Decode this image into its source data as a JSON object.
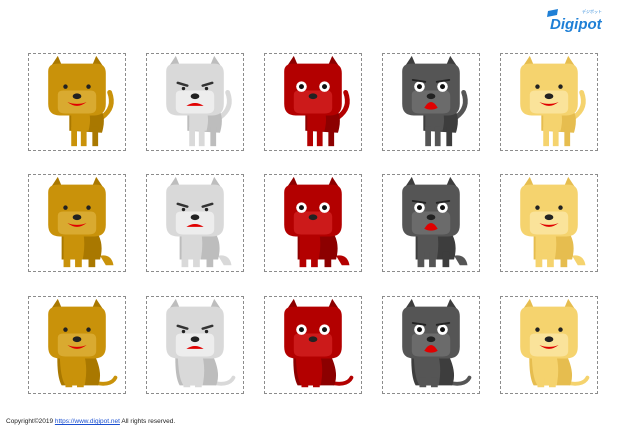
{
  "logo": {
    "text": "Digipot",
    "small_text": "デジポット",
    "icon": "digipot-logo-icon",
    "color": "#1e7fd6"
  },
  "footer": {
    "prefix": "Copyright©2019 ",
    "link_text": "https://www.digipot.net",
    "suffix": " All rights reserved."
  },
  "palette": {
    "tan": {
      "body": "#c9920a",
      "shade": "#a97800",
      "snout": "#d9aa30"
    },
    "white": {
      "body": "#d9d9d9",
      "shade": "#bdbdbd",
      "snout": "#ededed"
    },
    "red": {
      "body": "#b30000",
      "shade": "#8c0000",
      "snout": "#cc1a1a"
    },
    "gray": {
      "body": "#555555",
      "shade": "#3d3d3d",
      "snout": "#6b6b6b"
    },
    "cream": {
      "body": "#f5d36e",
      "shade": "#e6bd4f",
      "snout": "#fae39a"
    }
  },
  "rows": [
    {
      "pose": "stand",
      "dogs": [
        {
          "color": "tan",
          "expression": "smile"
        },
        {
          "color": "white",
          "expression": "frown"
        },
        {
          "color": "red",
          "expression": "stare"
        },
        {
          "color": "gray",
          "expression": "shock"
        },
        {
          "color": "cream",
          "expression": "smile"
        }
      ]
    },
    {
      "pose": "tall",
      "dogs": [
        {
          "color": "tan",
          "expression": "smile"
        },
        {
          "color": "white",
          "expression": "frown"
        },
        {
          "color": "red",
          "expression": "stare"
        },
        {
          "color": "gray",
          "expression": "shock"
        },
        {
          "color": "cream",
          "expression": "smile"
        }
      ]
    },
    {
      "pose": "sit",
      "dogs": [
        {
          "color": "tan",
          "expression": "smile"
        },
        {
          "color": "white",
          "expression": "frown"
        },
        {
          "color": "red",
          "expression": "stare"
        },
        {
          "color": "gray",
          "expression": "shock"
        },
        {
          "color": "cream",
          "expression": "smile"
        }
      ]
    }
  ]
}
